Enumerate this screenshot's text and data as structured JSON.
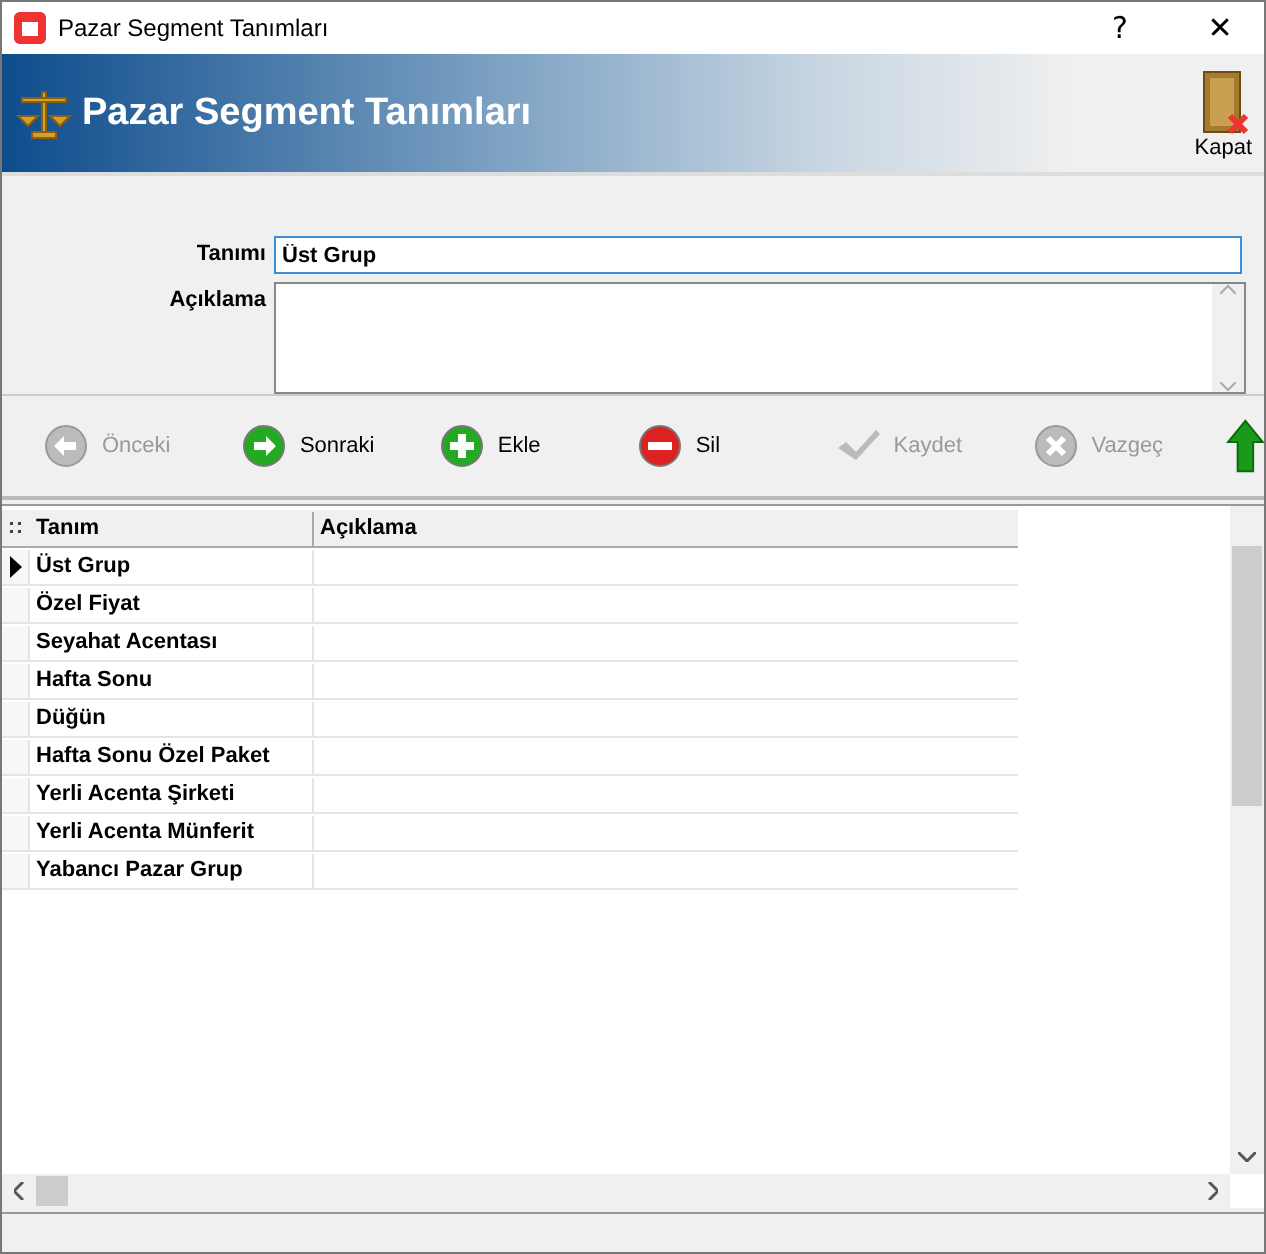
{
  "window": {
    "title": "Pazar Segment Tanımları",
    "help": "?",
    "close": "✕"
  },
  "header": {
    "title": "Pazar Segment Tanımları",
    "close_label": "Kapat"
  },
  "form": {
    "fields": [
      {
        "label": "Tanımı",
        "value": "Üst Grup",
        "kind": "line"
      },
      {
        "label": "Açıklama",
        "kind": "memo"
      }
    ]
  },
  "toolbar": [
    {
      "label": "Önceki",
      "kind": "prev",
      "disabled": true
    },
    {
      "label": "Sonraki",
      "kind": "next",
      "disabled": false
    },
    {
      "label": "Ekle",
      "kind": "add",
      "disabled": false
    },
    {
      "label": "Sil",
      "kind": "delete",
      "disabled": false
    },
    {
      "label": "Kaydet",
      "kind": "save",
      "disabled": true
    },
    {
      "label": "Vazgeç",
      "kind": "cancel",
      "disabled": true
    }
  ],
  "table": {
    "columns": [
      "Tanım",
      "Açıklama"
    ],
    "rows": [
      {
        "tanim": "Üst Grup",
        "selected": true
      },
      {
        "tanim": "Özel Fiyat",
        "selected": false
      },
      {
        "tanim": "Seyahat Acentası",
        "selected": false
      },
      {
        "tanim": "Hafta Sonu",
        "selected": false
      },
      {
        "tanim": "Düğün",
        "selected": false
      },
      {
        "tanim": "Hafta Sonu Özel Paket",
        "selected": false
      },
      {
        "tanim": "Yerli Acenta Şirketi",
        "selected": false
      },
      {
        "tanim": "Yerli Acenta Münferit",
        "selected": false
      },
      {
        "tanim": "Yabancı Pazar Grup",
        "selected": false
      }
    ]
  }
}
